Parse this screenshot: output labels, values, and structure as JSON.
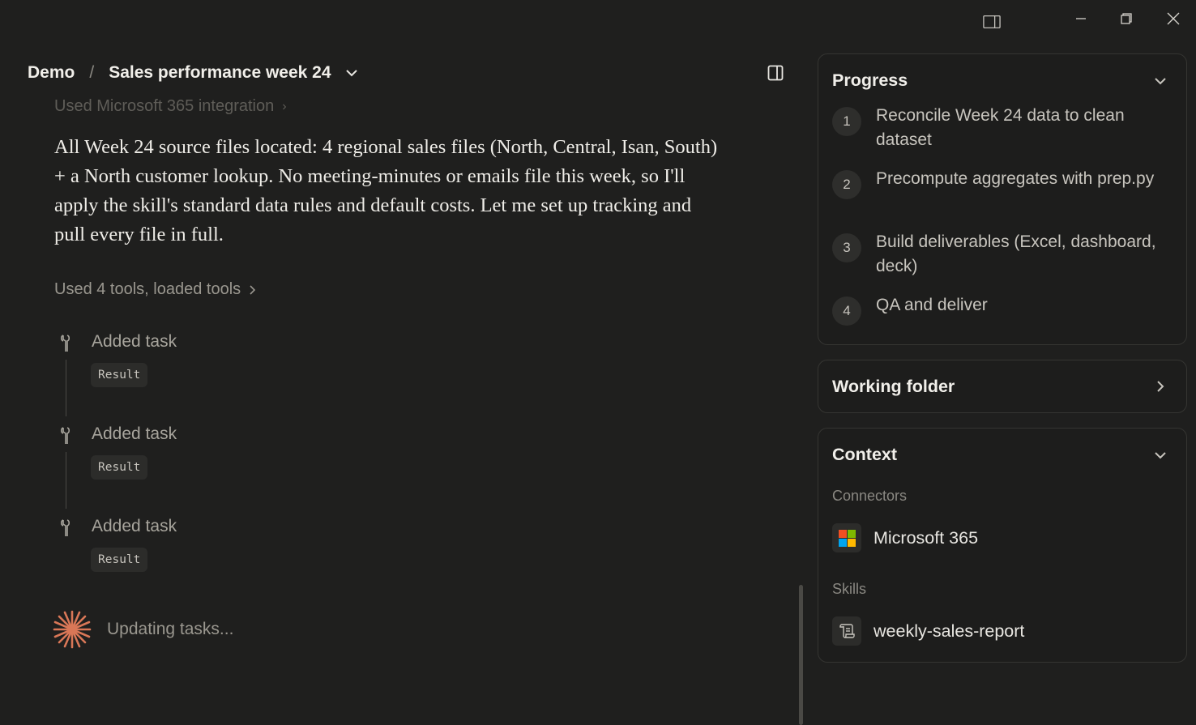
{
  "window": {
    "panel_icon": "sidebar-panel-icon",
    "minimize_icon": "minimize-icon",
    "restore_icon": "restore-icon",
    "close_icon": "close-icon"
  },
  "header": {
    "root": "Demo",
    "separator": "/",
    "title": "Sales performance week 24"
  },
  "chat": {
    "faded_line": "Used Microsoft 365 integration",
    "message": "All Week 24 source files located: 4 regional sales files (North, Central, Isan, South) + a North customer lookup. No meeting-minutes or emails file this week, so I'll apply the skill's standard data rules and default costs. Let me set up tracking and pull every file in full.",
    "tools_summary": "Used 4 tools, loaded tools",
    "tasks": [
      {
        "label": "Added task",
        "result": "Result"
      },
      {
        "label": "Added task",
        "result": "Result"
      },
      {
        "label": "Added task",
        "result": "Result"
      }
    ],
    "status": "Updating tasks..."
  },
  "sidebar": {
    "progress": {
      "title": "Progress",
      "steps": [
        {
          "num": "1",
          "text": "Reconcile Week 24 data to clean dataset"
        },
        {
          "num": "2",
          "text": "Precompute aggregates with prep.py"
        },
        {
          "num": "3",
          "text": "Build deliverables (Excel, dashboard, deck)"
        },
        {
          "num": "4",
          "text": "QA and deliver"
        }
      ]
    },
    "working_folder": {
      "title": "Working folder"
    },
    "context": {
      "title": "Context",
      "connectors_label": "Connectors",
      "connector": "Microsoft 365",
      "skills_label": "Skills",
      "skill": "weekly-sales-report"
    }
  },
  "colors": {
    "background": "#1f1f1e",
    "accent": "#d97757",
    "ms_red": "#f25022",
    "ms_green": "#7fba00",
    "ms_blue": "#00a4ef",
    "ms_yellow": "#ffb900"
  }
}
